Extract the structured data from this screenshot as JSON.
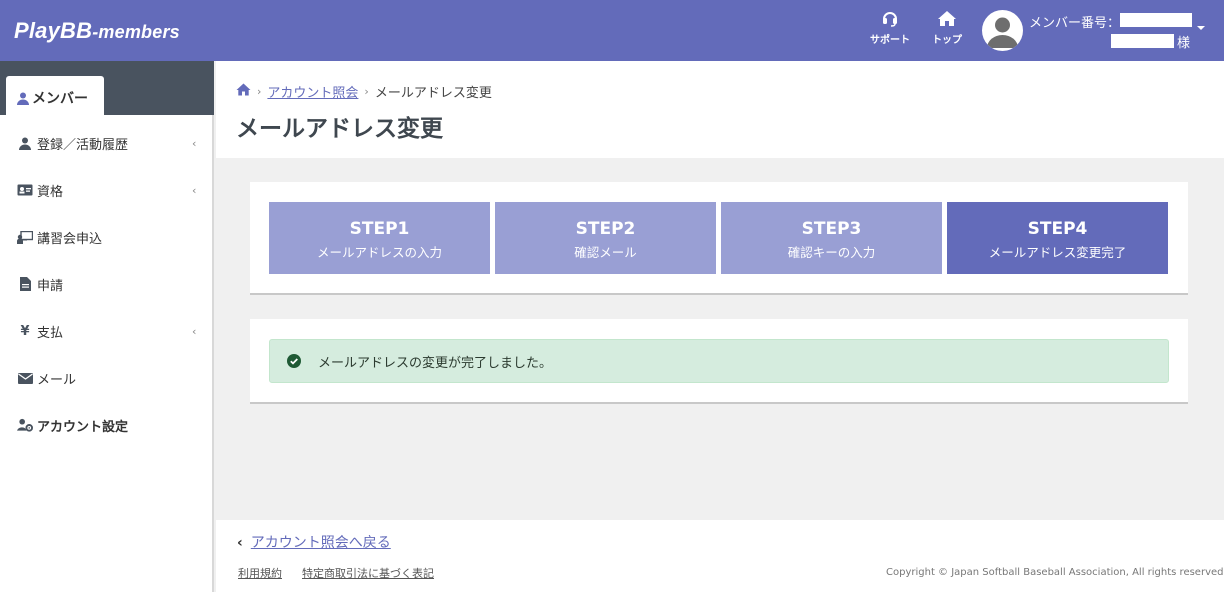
{
  "header": {
    "logo_main": "PlayBB",
    "logo_sub": "-members",
    "support_label": "サポート",
    "top_label": "トップ",
    "member_number_label": "メンバー番号：",
    "honorific": "様"
  },
  "sidebar": {
    "active_tab": "メンバー",
    "items": [
      {
        "label": "登録／活動履歴",
        "icon": "user-icon",
        "has_submenu": true
      },
      {
        "label": "資格",
        "icon": "id-card-icon",
        "has_submenu": true
      },
      {
        "label": "講習会申込",
        "icon": "chalkboard-teacher-icon",
        "has_submenu": false
      },
      {
        "label": "申請",
        "icon": "document-icon",
        "has_submenu": false
      },
      {
        "label": "支払",
        "icon": "yen-icon",
        "has_submenu": true
      },
      {
        "label": "メール",
        "icon": "envelope-icon",
        "has_submenu": false
      },
      {
        "label": "アカウント設定",
        "icon": "user-cog-icon",
        "has_submenu": false
      }
    ],
    "yen_glyph": "¥",
    "chevron_glyph": "‹"
  },
  "breadcrumb": {
    "separator": "›",
    "link": "アカウント照会",
    "current": "メールアドレス変更"
  },
  "page_title": "メールアドレス変更",
  "steps": [
    {
      "title": "STEP1",
      "subtitle": "メールアドレスの入力",
      "active": false
    },
    {
      "title": "STEP2",
      "subtitle": "確認メール",
      "active": false
    },
    {
      "title": "STEP3",
      "subtitle": "確認キーの入力",
      "active": false
    },
    {
      "title": "STEP4",
      "subtitle": "メールアドレス変更完了",
      "active": true
    }
  ],
  "alert": {
    "message": "メールアドレスの変更が完了しました。",
    "type": "success"
  },
  "footer": {
    "back_glyph": "‹",
    "back_link": "アカウント照会へ戻る",
    "terms_link": "利用規約",
    "commerce_link": "特定商取引法に基づく表記",
    "copyright": "Copyright © Japan Softball Baseball Association, All rights reserved."
  },
  "colors": {
    "header_bg": "#636bba",
    "sidebar_top_bg": "#49535f",
    "step_inactive": "#999fd4",
    "step_active": "#636bba",
    "alert_bg": "#d5ecde",
    "link": "#636bba"
  }
}
